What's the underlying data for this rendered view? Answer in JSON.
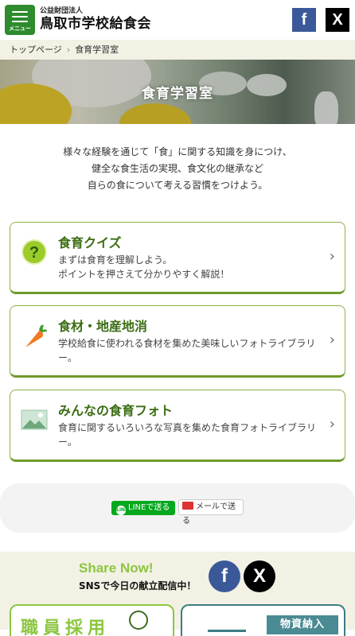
{
  "header": {
    "menu_label": "メニュー",
    "org_small": "公益財団法人",
    "org_name": "鳥取市学校給食会",
    "facebook": "f",
    "x": "X"
  },
  "breadcrumb": {
    "home": "トップページ",
    "separator": "›",
    "current": "食育学習室"
  },
  "hero": {
    "title": "食育学習室"
  },
  "intro": {
    "lines": [
      "様々な経験を通じて「食」に関する知識を身につけ、",
      "健全な食生活の実現、食文化の継承など",
      "自らの食について考える習慣をつけよう。"
    ]
  },
  "cards": [
    {
      "title": "食育クイズ",
      "desc1": "まずは食育を理解しよう。",
      "desc2": "ポイントを押さえて分かりやすく解説！",
      "icon": "question-icon"
    },
    {
      "title": "食材・地産地消",
      "desc1": "学校給食に使われる食材を集めた美味しいフォトライブラリー。",
      "icon": "carrot-icon"
    },
    {
      "title": "みんなの食育フォト",
      "desc1": "食育に関するいろいろな写真を集めた食育フォトライブラリー。",
      "icon": "photo-icon"
    }
  ],
  "share": {
    "line_label": "LINEで送る",
    "line_logo": "LINE",
    "mail_label": "メールで送る"
  },
  "footer": {
    "share_now": "Share Now!",
    "sns_text": "SNSで今日の献立配信中！",
    "facebook": "f",
    "x": "X",
    "banner_left": "職員採用",
    "banner_right": "物資納入"
  },
  "colors": {
    "brand_green": "#2e8b2e",
    "card_green": "#3c6d14",
    "accent_lime": "#8cc63f",
    "facebook_blue": "#3b5998"
  }
}
